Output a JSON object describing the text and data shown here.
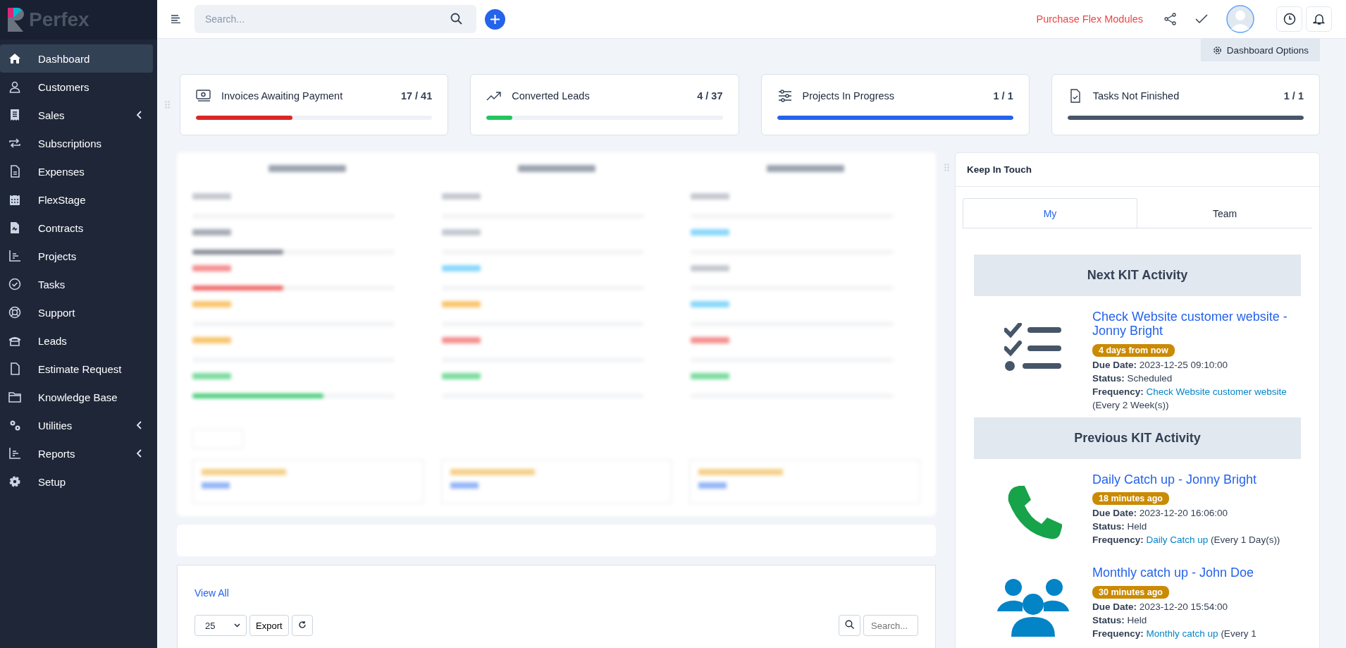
{
  "brand": {
    "name": "Perfex"
  },
  "sidebar": {
    "items": [
      {
        "label": "Dashboard",
        "selected": true,
        "has_submenu": false
      },
      {
        "label": "Customers",
        "selected": false,
        "has_submenu": false
      },
      {
        "label": "Sales",
        "selected": false,
        "has_submenu": true
      },
      {
        "label": "Subscriptions",
        "selected": false,
        "has_submenu": false
      },
      {
        "label": "Expenses",
        "selected": false,
        "has_submenu": false
      },
      {
        "label": "FlexStage",
        "selected": false,
        "has_submenu": false
      },
      {
        "label": "Contracts",
        "selected": false,
        "has_submenu": false
      },
      {
        "label": "Projects",
        "selected": false,
        "has_submenu": false
      },
      {
        "label": "Tasks",
        "selected": false,
        "has_submenu": false
      },
      {
        "label": "Support",
        "selected": false,
        "has_submenu": false
      },
      {
        "label": "Leads",
        "selected": false,
        "has_submenu": false
      },
      {
        "label": "Estimate Request",
        "selected": false,
        "has_submenu": false
      },
      {
        "label": "Knowledge Base",
        "selected": false,
        "has_submenu": false
      },
      {
        "label": "Utilities",
        "selected": false,
        "has_submenu": true
      },
      {
        "label": "Reports",
        "selected": false,
        "has_submenu": true
      },
      {
        "label": "Setup",
        "selected": false,
        "has_submenu": false
      }
    ]
  },
  "topbar": {
    "search": {
      "placeholder": "Search..."
    },
    "purchase_link": "Purchase Flex Modules"
  },
  "dashboard_options": "Dashboard Options",
  "stat_cards": [
    {
      "title": "Invoices Awaiting Payment",
      "count": "17 / 41",
      "level": 0.41,
      "color": "#dc2626"
    },
    {
      "title": "Converted Leads",
      "count": "4 / 37",
      "level": 0.11,
      "color": "#22c55e"
    },
    {
      "title": "Projects In Progress",
      "count": "1 / 1",
      "level": 1,
      "color": "#2563eb"
    },
    {
      "title": "Tasks Not Finished",
      "count": "1 / 1",
      "level": 1,
      "color": "#475569"
    }
  ],
  "table_panel": {
    "view_all": "View All",
    "page_size": "25",
    "export": "Export",
    "search": {
      "placeholder": "Search..."
    }
  },
  "keep_in_touch": {
    "title": "Keep In Touch",
    "tabs": [
      {
        "label": "My",
        "selected": true
      },
      {
        "label": "Team",
        "selected": false
      }
    ],
    "sections": [
      {
        "heading": "Next KIT Activity",
        "activities": [
          {
            "kind": "checklist",
            "title": "Check Website customer website - Jonny Bright",
            "badge": "4 days from now",
            "due_label": "Due Date:",
            "due": "2023-12-25 09:10:00",
            "status_label": "Status:",
            "status": "Scheduled",
            "frequency_label": "Frequency:",
            "frequency_link": "Check Website customer website",
            "frequency_note": "(Every 2 Week(s))"
          }
        ]
      },
      {
        "heading": "Previous KIT Activity",
        "activities": [
          {
            "kind": "phone",
            "title": "Daily Catch up - Jonny Bright",
            "badge": "18 minutes ago",
            "due_label": "Due Date:",
            "due": "2023-12-20 16:06:00",
            "status_label": "Status:",
            "status": "Held",
            "frequency_label": "Frequency:",
            "frequency_link": "Daily Catch up",
            "frequency_note": "(Every 1 Day(s))"
          },
          {
            "kind": "group",
            "title": "Monthly catch up - John Doe",
            "badge": "30 minutes ago",
            "due_label": "Due Date:",
            "due": "2023-12-20 15:54:00",
            "status_label": "Status:",
            "status": "Held",
            "frequency_label": "Frequency:",
            "frequency_link": "Monthly catch up",
            "frequency_note": "(Every 1"
          }
        ]
      }
    ]
  }
}
